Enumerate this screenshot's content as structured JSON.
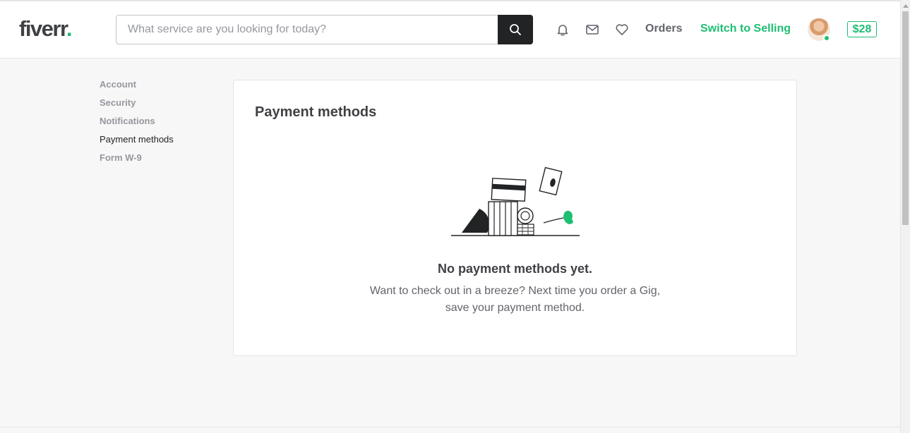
{
  "header": {
    "logo": {
      "text": "fiverr",
      "dot": "."
    },
    "search": {
      "placeholder": "What service are you looking for today?",
      "value": "",
      "button_icon": "search-icon"
    },
    "icons": [
      "bell-icon",
      "envelope-icon",
      "heart-icon"
    ],
    "orders_label": "Orders",
    "switch_label": "Switch to Selling",
    "balance": "$28",
    "avatar_online": true
  },
  "sidebar": {
    "items": [
      {
        "label": "Account",
        "active": false
      },
      {
        "label": "Security",
        "active": false
      },
      {
        "label": "Notifications",
        "active": false
      },
      {
        "label": "Payment methods",
        "active": true
      },
      {
        "label": "Form W-9",
        "active": false
      }
    ]
  },
  "main": {
    "title": "Payment methods",
    "empty_title": "No payment methods yet.",
    "empty_desc_line1": "Want to check out in a breeze? Next time you order a Gig,",
    "empty_desc_line2": "save your payment method."
  },
  "colors": {
    "brand_green": "#1dbf73",
    "text_dark": "#404145",
    "text_muted": "#95979d",
    "search_button": "#222325"
  }
}
